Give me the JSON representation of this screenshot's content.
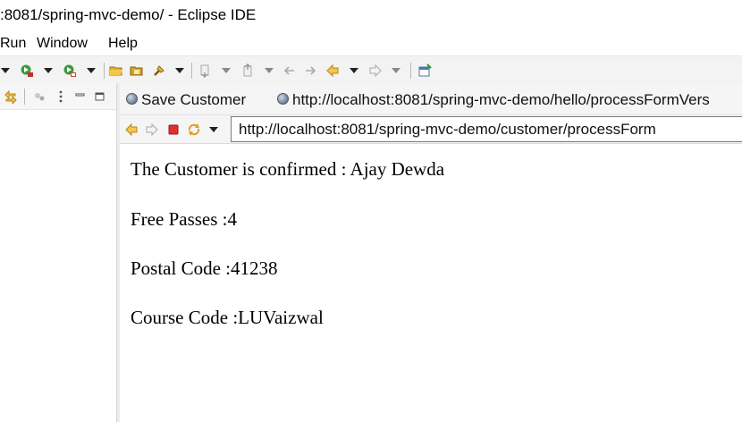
{
  "window": {
    "title": ":8081/spring-mvc-demo/ - Eclipse IDE"
  },
  "menubar": {
    "items": [
      "Run",
      "Window",
      "Help"
    ]
  },
  "toolbar": {
    "icons": [
      "run-dropdown",
      "coverage-dropdown",
      "external-tools-dropdown",
      "open-folder",
      "open-type",
      "search",
      "next-annotation",
      "previous-annotation",
      "last-edit-location",
      "back",
      "forward",
      "new-window"
    ]
  },
  "browser": {
    "tabs": [
      {
        "label": "Save Customer",
        "icon": "globe-icon"
      },
      {
        "label": "http://localhost:8081/spring-mvc-demo/hello/processFormVers",
        "icon": "globe-icon"
      }
    ],
    "url": "http://localhost:8081/spring-mvc-demo/customer/processForm",
    "nav": {
      "back_icon": "back-arrow-icon",
      "forward_icon": "forward-arrow-icon",
      "stop_icon": "stop-icon",
      "refresh_icon": "refresh-icon"
    }
  },
  "page": {
    "lines": [
      "The Customer is confirmed : Ajay Dewda",
      "Free Passes :4",
      "Postal Code :41238",
      "Course Code :LUVaizwal"
    ]
  },
  "colors": {
    "toolbar_bg": "#f3f3f3",
    "panel_bg": "#f5f5f5",
    "stop_red": "#e03030",
    "nav_orange": "#f0a000"
  }
}
